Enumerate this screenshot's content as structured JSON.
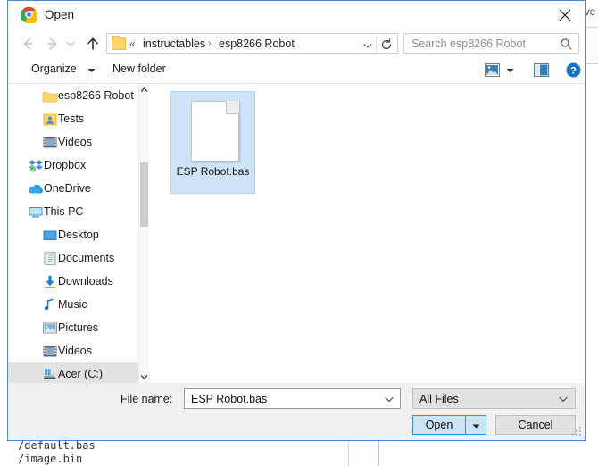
{
  "background": {
    "right_edge_text": "ive",
    "code_line_1": "/default.bas",
    "code_line_2": "/image.bin"
  },
  "dialog": {
    "title": "Open",
    "app_icon": "chrome-logo-icon",
    "close_icon": "close-icon"
  },
  "nav": {
    "back_icon": "arrow-left-icon",
    "forward_icon": "arrow-right-icon",
    "recent_icon": "chevron-down-icon",
    "up_icon": "arrow-up-icon"
  },
  "address": {
    "folder_icon": "folder-icon",
    "overflow": "«",
    "crumb_1": "instructables",
    "separator": "›",
    "crumb_2": "esp8266 Robot",
    "dropdown_icon": "chevron-down-icon",
    "refresh_icon": "refresh-icon"
  },
  "search": {
    "placeholder": "Search esp8266 Robot",
    "icon": "search-icon"
  },
  "toolbar": {
    "organize": "Organize",
    "organize_chevron": "chevron-down-icon",
    "new_folder": "New folder",
    "view_icon": "view-layout-icon",
    "view_chevron": "chevron-down-icon",
    "preview_pane_icon": "preview-pane-icon",
    "help_icon": "help-icon"
  },
  "sidebar": {
    "items": [
      {
        "label": "esp8266 Robot",
        "icon": "folder-icon",
        "indent": 2,
        "selected": false
      },
      {
        "label": "Tests",
        "icon": "user-folder-icon",
        "indent": 2,
        "selected": false
      },
      {
        "label": "Videos",
        "icon": "videos-icon",
        "indent": 2,
        "selected": false
      },
      {
        "label": "Dropbox",
        "icon": "dropbox-icon",
        "indent": 1,
        "selected": false
      },
      {
        "label": "OneDrive",
        "icon": "onedrive-icon",
        "indent": 1,
        "selected": false
      },
      {
        "label": "This PC",
        "icon": "this-pc-icon",
        "indent": 1,
        "selected": false
      },
      {
        "label": "Desktop",
        "icon": "desktop-icon",
        "indent": 2,
        "selected": false
      },
      {
        "label": "Documents",
        "icon": "documents-icon",
        "indent": 2,
        "selected": false
      },
      {
        "label": "Downloads",
        "icon": "downloads-icon",
        "indent": 2,
        "selected": false
      },
      {
        "label": "Music",
        "icon": "music-icon",
        "indent": 2,
        "selected": false
      },
      {
        "label": "Pictures",
        "icon": "pictures-icon",
        "indent": 2,
        "selected": false
      },
      {
        "label": "Videos",
        "icon": "videos-icon",
        "indent": 2,
        "selected": false
      },
      {
        "label": "Acer (C:)",
        "icon": "drive-icon",
        "indent": 2,
        "selected": true
      }
    ],
    "scrollbar": {
      "up_icon": "chevron-up-icon",
      "down_icon": "chevron-down-icon"
    }
  },
  "files": [
    {
      "name": "ESP Robot.bas",
      "icon": "document-icon",
      "selected": true
    }
  ],
  "footer": {
    "filename_label": "File name:",
    "filename_value": "ESP Robot.bas",
    "filename_chevron": "chevron-down-icon",
    "filetype_value": "All Files",
    "filetype_chevron": "chevron-down-icon",
    "open_label": "Open",
    "open_split_chevron": "chevron-down-icon",
    "cancel_label": "Cancel",
    "resize_grip_icon": "resize-grip-icon"
  },
  "colors": {
    "accent": "#3a8fd0",
    "selection": "#cde3f7",
    "dialog_border": "#4c8bc4",
    "folder_yellow": "#fcd66a"
  }
}
